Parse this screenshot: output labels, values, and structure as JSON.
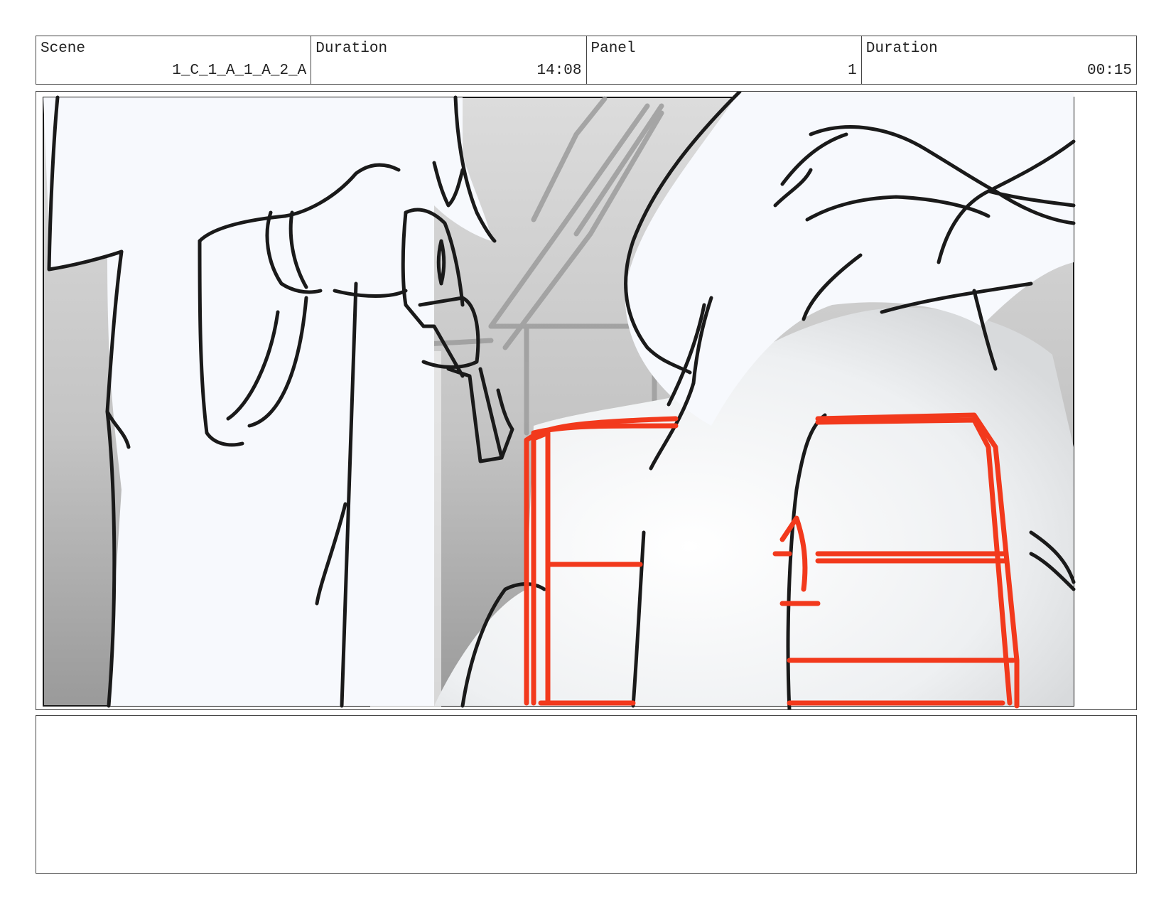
{
  "header": {
    "scene": {
      "label": "Scene",
      "value": "1_C_1_A_1_A_2_A"
    },
    "scene_duration": {
      "label": "Duration",
      "value": "14:08"
    },
    "panel": {
      "label": "Panel",
      "value": "1"
    },
    "panel_duration": {
      "label": "Duration",
      "value": "00:15"
    }
  },
  "sketch": {
    "colors": {
      "ink": "#1a1a1a",
      "highlight": "#f2391c",
      "background_light": "#dcdcdc",
      "background_dark": "#9a9a9a",
      "figure_fill": "#f7f9fd"
    }
  },
  "notes": {
    "text": ""
  }
}
